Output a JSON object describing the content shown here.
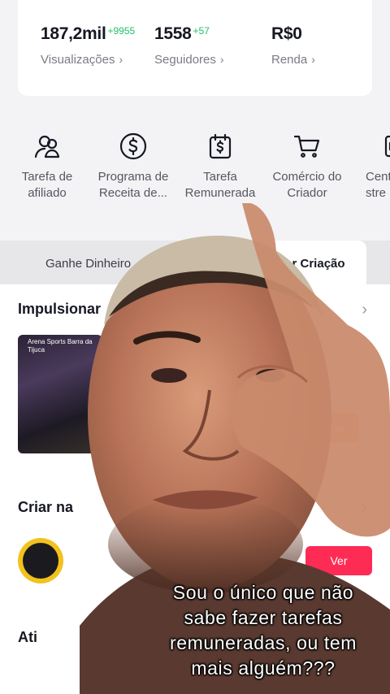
{
  "stats": [
    {
      "value": "187,2mil",
      "delta": "+9955",
      "label": "Visualizações"
    },
    {
      "value": "1558",
      "delta": "+57",
      "label": "Seguidores"
    },
    {
      "value": "R$0",
      "delta": "",
      "label": "Renda"
    }
  ],
  "tools": [
    {
      "icon": "affiliate-people-icon",
      "line1": "Tarefa de",
      "line2": "afiliado"
    },
    {
      "icon": "dollar-circle-icon",
      "line1": "Programa de",
      "line2": "Receita de..."
    },
    {
      "icon": "paid-task-calendar-icon",
      "line1": "Tarefa",
      "line2": "Remunerada"
    },
    {
      "icon": "cart-icon",
      "line1": "Comércio do",
      "line2": "Criador"
    },
    {
      "icon": "creator-center-icon",
      "line1": "Cent",
      "line2": "stre"
    }
  ],
  "tabs": {
    "earn": "Ganhe Dinheiro",
    "creation": "Melhorar Criação"
  },
  "sections": {
    "boost": {
      "title": "Impulsionar",
      "button": "Impulsionar",
      "thumb_caption": "Arena Sports Barra da Tijuca"
    },
    "create": {
      "title": "Criar na",
      "button": "Ver"
    },
    "activity": {
      "title": "Ati"
    }
  },
  "subtitle": [
    "Sou o único que não",
    "sabe fazer tarefas",
    "remuneradas, ou tem",
    "mais alguém???"
  ],
  "colors": {
    "accent": "#fe2c55",
    "positive": "#20c06a",
    "text": "#161823",
    "muted": "#7a7c85"
  }
}
